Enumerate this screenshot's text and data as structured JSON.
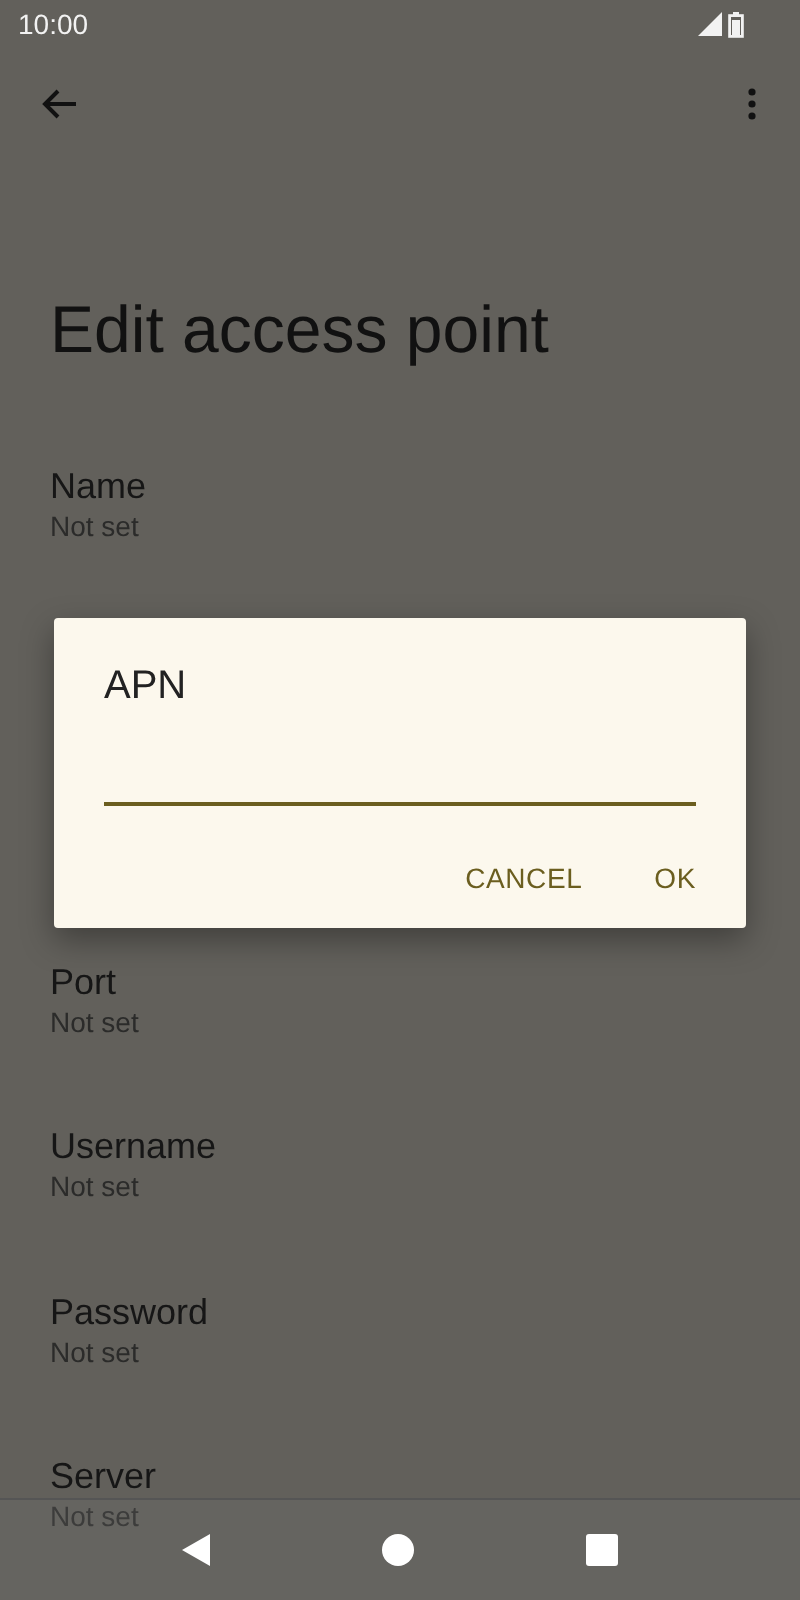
{
  "status_bar": {
    "time": "10:00"
  },
  "title": "Edit access point",
  "settings": [
    {
      "kind": "setting",
      "label": "Name",
      "value": "Not set"
    },
    {
      "kind": "covered"
    },
    {
      "kind": "covered"
    },
    {
      "kind": "setting",
      "label": "Port",
      "value": "Not set"
    },
    {
      "kind": "setting",
      "label": "Username",
      "value": "Not set"
    },
    {
      "kind": "setting",
      "label": "Password",
      "value": "Not set"
    },
    {
      "kind": "setting",
      "label": "Server",
      "value": "Not set"
    }
  ],
  "dialog": {
    "title": "APN",
    "buttons": [
      "CANCEL",
      "OK"
    ]
  }
}
